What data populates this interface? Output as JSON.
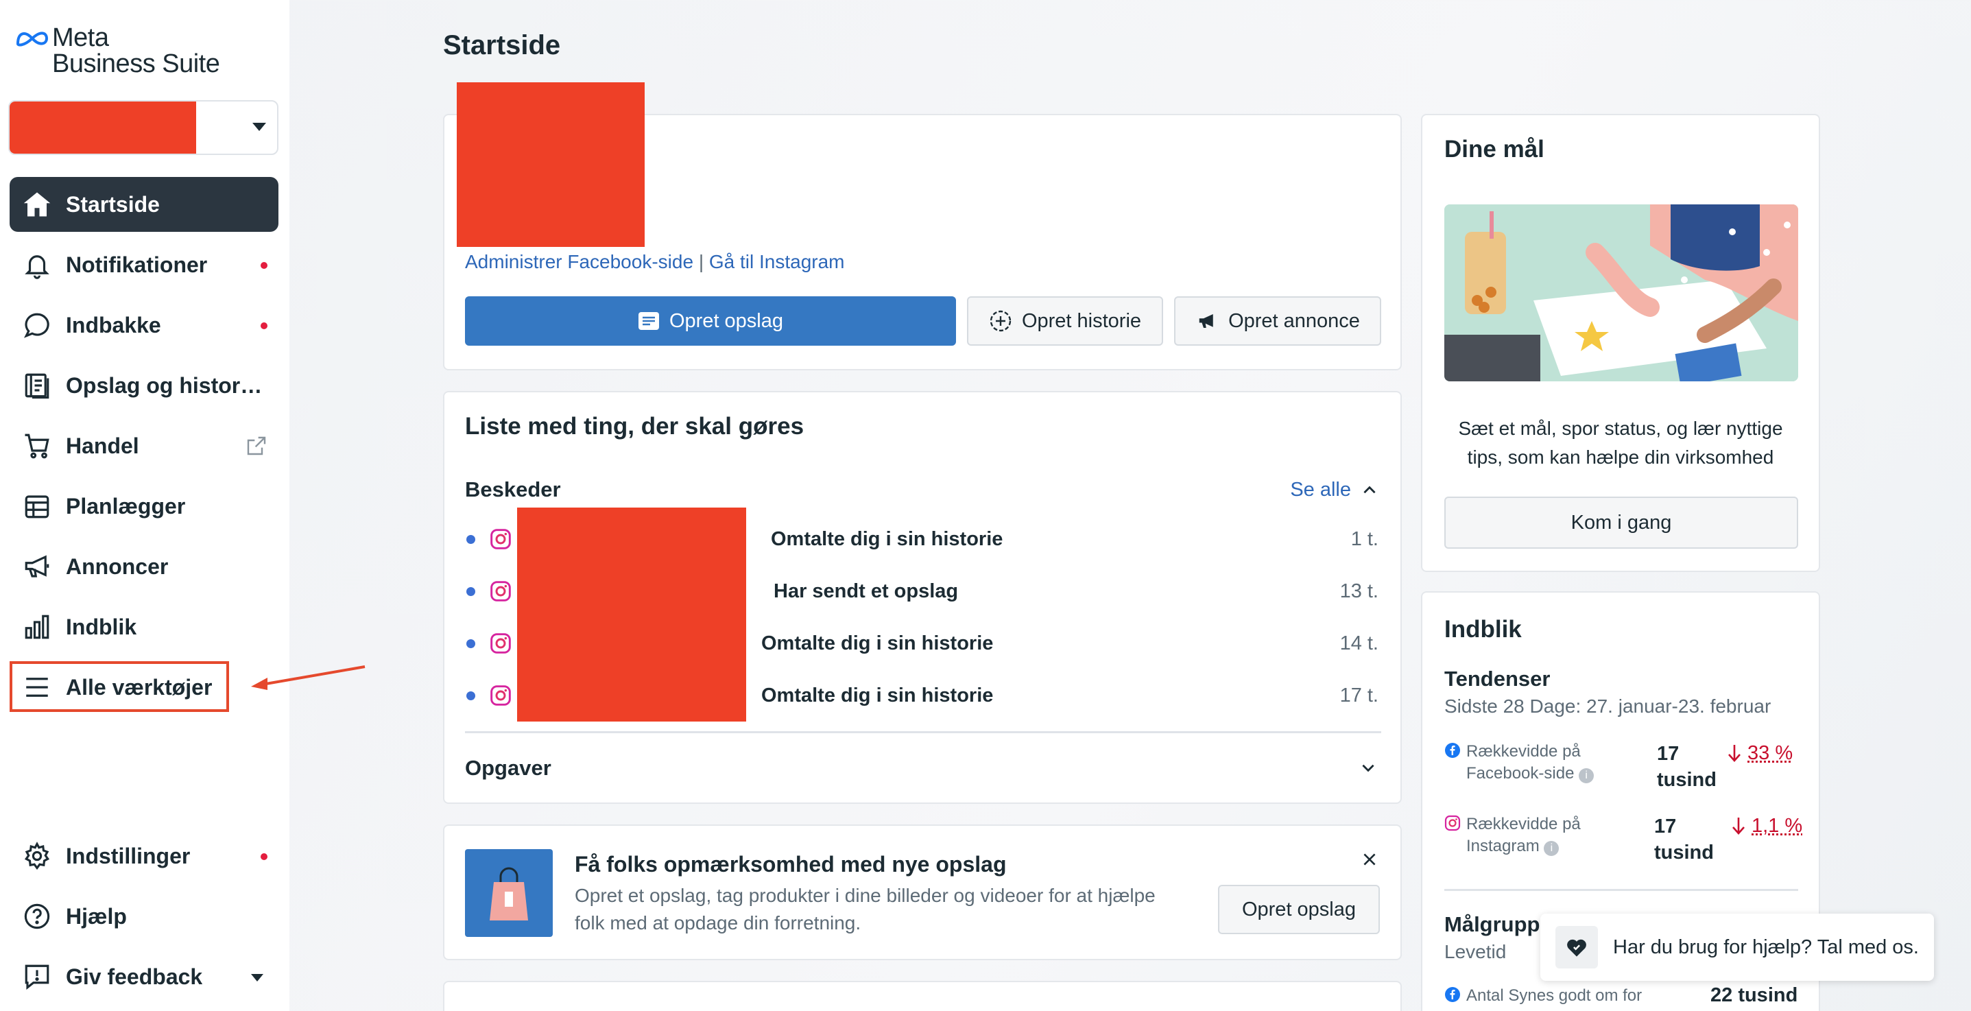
{
  "brand": {
    "line1": "Meta",
    "line2": "Business Suite"
  },
  "colors": {
    "accent": "#3578c2",
    "sidebar_active": "#2b3640",
    "notification_dot": "#e41e3f",
    "redaction": "#ee4027",
    "annotation": "#e5492d"
  },
  "sidebar": {
    "items": [
      {
        "label": "Startside",
        "icon": "home-icon",
        "active": true,
        "dot": false
      },
      {
        "label": "Notifikationer",
        "icon": "bell-icon",
        "dot": true
      },
      {
        "label": "Indbakke",
        "icon": "chat-bubble-icon",
        "dot": true
      },
      {
        "label": "Opslag og historier",
        "icon": "posts-icon",
        "dot": false
      },
      {
        "label": "Handel",
        "icon": "cart-icon",
        "external": true
      },
      {
        "label": "Planlægger",
        "icon": "calendar-icon"
      },
      {
        "label": "Annoncer",
        "icon": "megaphone-icon"
      },
      {
        "label": "Indblik",
        "icon": "bar-chart-icon"
      },
      {
        "label": "Alle værktøjer",
        "icon": "menu-lines-icon",
        "highlighted": true
      }
    ],
    "bottom": [
      {
        "label": "Indstillinger",
        "icon": "gear-icon",
        "dot": true
      },
      {
        "label": "Hjælp",
        "icon": "help-circle-icon"
      },
      {
        "label": "Giv feedback",
        "icon": "feedback-icon"
      }
    ]
  },
  "main": {
    "title": "Startside",
    "profile": {
      "manage_fb": "Administrer Facebook-side",
      "separator": "|",
      "goto_ig": "Gå til Instagram",
      "btn_post": "Opret opslag",
      "btn_story": "Opret historie",
      "btn_ad": "Opret annonce"
    },
    "todo": {
      "title": "Liste med ting, der skal gøres",
      "messages_title": "Beskeder",
      "see_all": "Se alle",
      "messages": [
        {
          "text": "Omtalte dig i sin historie",
          "time": "1 t."
        },
        {
          "text": "Har sendt et opslag",
          "time": "13 t."
        },
        {
          "text": "Omtalte dig i sin historie",
          "time": "14 t."
        },
        {
          "text": "Omtalte dig i sin historie",
          "time": "17 t."
        }
      ],
      "tasks_title": "Opgaver"
    },
    "promo": {
      "title": "Få folks opmærksomhed med nye opslag",
      "line1": "Opret et opslag, tag produkter i dine billeder og videoer for at hjælpe",
      "line2": "folk med at opdage din forretning.",
      "button": "Opret opslag"
    }
  },
  "right": {
    "goals": {
      "title": "Dine mål",
      "line1": "Sæt et mål, spor status, og lær nyttige",
      "line2": "tips, som kan hælpe din virksomhed",
      "button": "Kom i gang"
    },
    "insights": {
      "title": "Indblik",
      "trends_title": "Tendenser",
      "period": "Sidste 28 Dage: 27. januar-23. februar",
      "kpis": [
        {
          "label1": "Rækkevidde på",
          "label2": "Facebook-side",
          "val1": "17",
          "val2": "tusind",
          "delta": "33 %",
          "platform": "facebook-icon"
        },
        {
          "label1": "Rækkevidde på",
          "label2": "Instagram",
          "val1": "17",
          "val2": "tusind",
          "delta": "1,1 %",
          "platform": "instagram-icon"
        }
      ],
      "audience_title": "Målgrupp",
      "audience_sub": "Levetid",
      "audience_row_label": "Antal Synes godt om for",
      "audience_row_value": "22 tusind"
    }
  },
  "chat": {
    "text": "Har du brug for hjælp? Tal med os."
  }
}
